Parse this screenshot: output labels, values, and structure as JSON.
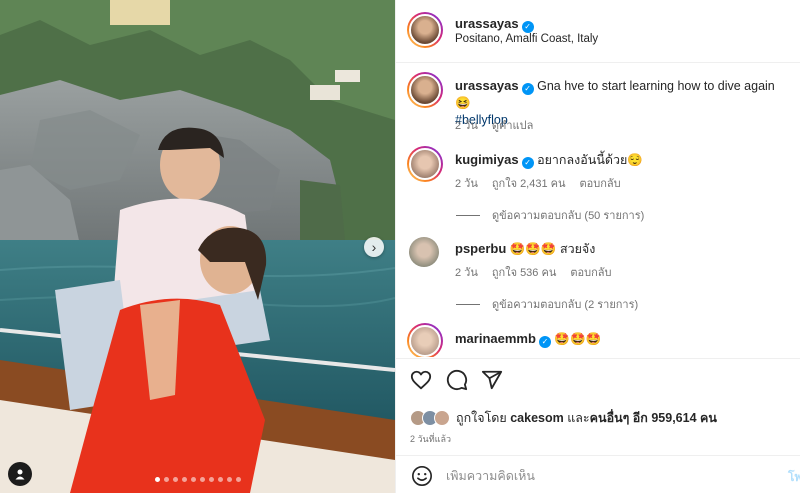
{
  "post": {
    "author": "urassayas",
    "location": "Positano, Amalfi Coast, Italy",
    "carousel": {
      "total": 10,
      "active": 1
    }
  },
  "caption": {
    "username": "urassayas",
    "text": "Gna hve to start learning how to dive again 😆",
    "hashtag": "#bellyflop",
    "time": "2 วัน",
    "translate": "ดูคำแปล"
  },
  "comments": [
    {
      "username": "kugimiyas",
      "verified": true,
      "text": "อยากลงอันนี้ด้วย😌",
      "time": "2 วัน",
      "likes": "ถูกใจ 2,431 คน",
      "reply": "ตอบกลับ",
      "view_replies": "ดูข้อความตอบกลับ (50 รายการ)"
    },
    {
      "username": "psperbu",
      "verified": false,
      "text": "🤩🤩🤩 สวยจัง",
      "time": "2 วัน",
      "likes": "ถูกใจ 536 คน",
      "reply": "ตอบกลับ",
      "view_replies": "ดูข้อความตอบกลับ (2 รายการ)"
    },
    {
      "username": "marinaemmb",
      "verified": true,
      "text": "🤩🤩🤩"
    }
  ],
  "likes_line": {
    "prefix": "ถูกใจโดย",
    "user": "cakesom",
    "middle": "และ",
    "others": "คนอื่นๆ อีก 959,614 คน"
  },
  "time_ago": "2 วันที่แล้ว",
  "add_comment": {
    "placeholder": "เพิ่มความคิดเห็น",
    "post_label": "โพ"
  },
  "icons": {
    "verified": "verified-badge-icon",
    "like": "heart-icon",
    "comment": "comment-bubble-icon",
    "share": "paper-plane-icon",
    "emoji": "smiley-icon",
    "next": "chevron-right-icon",
    "tags": "user-tag-icon"
  },
  "colors": {
    "verified": "#0095f6",
    "link": "#00376b",
    "muted": "#737373",
    "post_disabled": "#b2dffc"
  }
}
